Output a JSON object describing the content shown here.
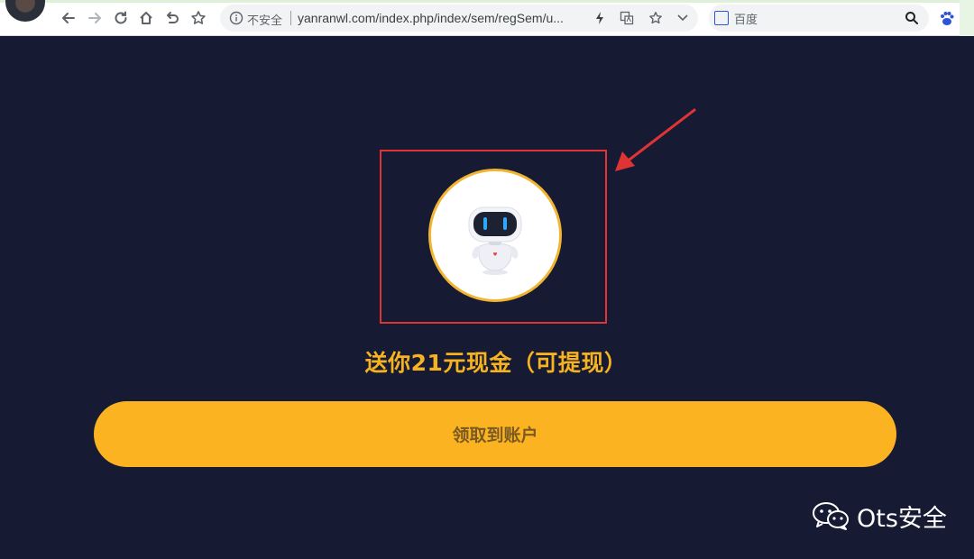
{
  "browser": {
    "insecure_label": "不安全",
    "url": "yanranwl.com/index.php/index/sem/regSem/u...",
    "search_placeholder": "百度",
    "icons": [
      "back-icon",
      "forward-icon",
      "reload-icon",
      "home-icon",
      "undo-icon",
      "star-icon",
      "info-icon",
      "lightning-icon",
      "translate-icon",
      "bookmark-star-icon",
      "chevron-down-icon",
      "search-icon",
      "baidu-paw-icon"
    ]
  },
  "page": {
    "promo_text": "送你21元现金（可提现）",
    "claim_button_label": "领取到账户",
    "colors": {
      "background": "#161a33",
      "accent": "#fbb322",
      "highlight": "#e03434"
    }
  },
  "watermark": {
    "text": "Ots安全"
  }
}
